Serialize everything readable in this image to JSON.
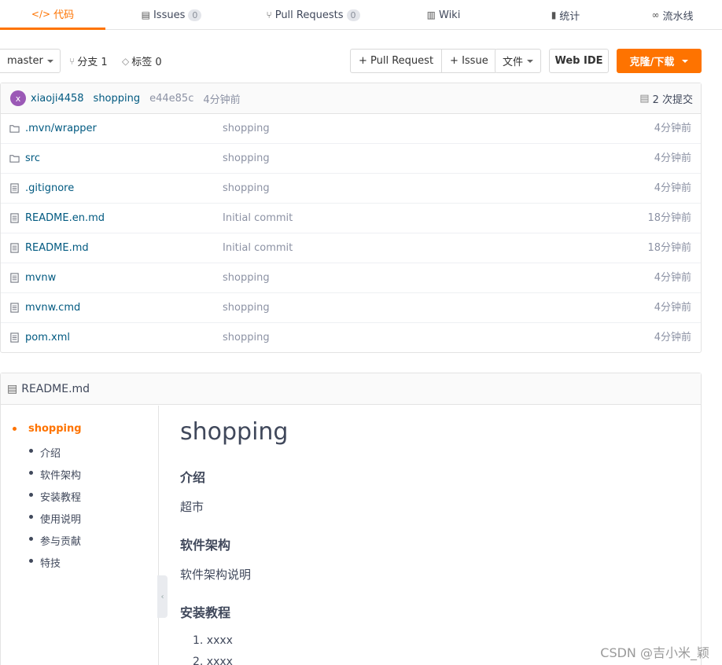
{
  "tabs": [
    {
      "label": "代码",
      "icon": "code-icon",
      "active": true
    },
    {
      "label": "Issues",
      "icon": "issues-icon",
      "badge": "0"
    },
    {
      "label": "Pull Requests",
      "icon": "pull-request-icon",
      "badge": "0"
    },
    {
      "label": "Wiki",
      "icon": "wiki-icon"
    },
    {
      "label": "统计",
      "icon": "stats-icon"
    },
    {
      "label": "流水线",
      "icon": "pipeline-icon"
    }
  ],
  "toolbar": {
    "branch": "master",
    "branches_label": "分支 1",
    "tags_label": "标签 0",
    "pull_request_btn": "+ Pull Request",
    "issue_btn": "+ Issue",
    "file_btn": "文件",
    "webide_btn": "Web IDE",
    "clone_btn": "克隆/下载"
  },
  "commit": {
    "avatar_letter": "x",
    "author": "xiaoji4458",
    "message": "shopping",
    "sha": "e44e85c",
    "time": "4分钟前",
    "count_label": "2 次提交"
  },
  "files": [
    {
      "name": ".mvn/wrapper",
      "type": "folder",
      "message": "shopping",
      "time": "4分钟前"
    },
    {
      "name": "src",
      "type": "folder",
      "message": "shopping",
      "time": "4分钟前"
    },
    {
      "name": ".gitignore",
      "type": "file",
      "message": "shopping",
      "time": "4分钟前"
    },
    {
      "name": "README.en.md",
      "type": "file",
      "message": "Initial commit",
      "time": "18分钟前"
    },
    {
      "name": "README.md",
      "type": "file",
      "message": "Initial commit",
      "time": "18分钟前"
    },
    {
      "name": "mvnw",
      "type": "file",
      "message": "shopping",
      "time": "4分钟前"
    },
    {
      "name": "mvnw.cmd",
      "type": "file",
      "message": "shopping",
      "time": "4分钟前"
    },
    {
      "name": "pom.xml",
      "type": "file",
      "message": "shopping",
      "time": "4分钟前"
    }
  ],
  "readme": {
    "title": "README.md",
    "toc": {
      "main": "shopping",
      "items": [
        "介绍",
        "软件架构",
        "安装教程",
        "使用说明",
        "参与贡献",
        "特技"
      ]
    },
    "content": {
      "h1": "shopping",
      "s1_title": "介绍",
      "s1_text": "超市",
      "s2_title": "软件架构",
      "s2_text": "软件架构说明",
      "s3_title": "安装教程",
      "list": [
        "1. xxxx",
        "2. xxxx"
      ]
    }
  },
  "watermark": "CSDN @吉小米_颖"
}
